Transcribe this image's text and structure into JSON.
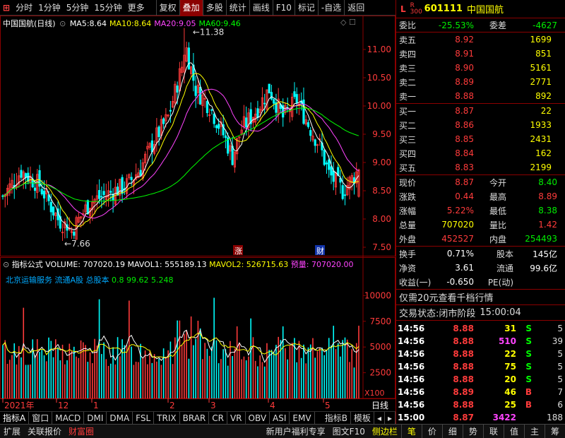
{
  "toolbar": {
    "periods": [
      "分时",
      "1分钟",
      "5分钟",
      "15分钟",
      "更多"
    ],
    "buttons": [
      "复权",
      "叠加",
      "多股",
      "统计",
      "画线",
      "F10",
      "标记",
      "-自选",
      "返回"
    ],
    "active": "叠加"
  },
  "price_chart": {
    "title": "中国国航(日线)",
    "ma": [
      {
        "name": "MA5:",
        "value": "8.64",
        "color": "#ffffff"
      },
      {
        "name": "MA10:",
        "value": "8.64",
        "color": "#ffff00"
      },
      {
        "name": "MA20:",
        "value": "9.05",
        "color": "#ff44ff"
      },
      {
        "name": "MA60:",
        "value": "9.46",
        "color": "#00ff00"
      }
    ],
    "high_label": "11.38",
    "low_label": "7.66",
    "markers": [
      "涨",
      "财"
    ]
  },
  "volume_chart": {
    "formula_label": "指标公式",
    "vol": {
      "name": "VOLUME:",
      "value": "707020.19"
    },
    "mavol1": {
      "name": "MAVOL1:",
      "value": "555189.13"
    },
    "mavol2": {
      "name": "MAVOL2:",
      "value": "526715.63"
    },
    "forecast": {
      "name": "预量:",
      "value": "707020.00"
    },
    "info_text": "北京运输服务 流通A股 总股本",
    "info_mixed": "0.8 99.62 5.248",
    "unit": "X100"
  },
  "time_axis": {
    "labels": [
      "2021年",
      "12",
      "1",
      "2",
      "3",
      "4",
      "5"
    ],
    "period": "日线"
  },
  "chart_data": [
    {
      "type": "candlestick",
      "y_ticks": [
        7.5,
        8.0,
        8.5,
        9.0,
        9.5,
        10.0,
        10.5,
        11.0
      ],
      "ylim": [
        7.35,
        11.6
      ],
      "series": [
        {
          "name": "MA5",
          "value": 8.64
        },
        {
          "name": "MA10",
          "value": 8.64
        },
        {
          "name": "MA20",
          "value": 9.05
        },
        {
          "name": "MA60",
          "value": 9.46
        }
      ],
      "high": 11.38,
      "low": 7.66,
      "last_close": 8.87
    },
    {
      "type": "bar",
      "y_ticks": [
        2500,
        5000,
        7500,
        10000
      ],
      "ylim": [
        0,
        12500
      ],
      "unit": "X100",
      "series": [
        {
          "name": "VOLUME",
          "value": 707020.19
        },
        {
          "name": "MAVOL1",
          "value": 555189.13
        },
        {
          "name": "MAVOL2",
          "value": 526715.63
        }
      ]
    }
  ],
  "stock": {
    "type_letter": "L",
    "code": "601111",
    "name": "中国国航",
    "sub": "R 300"
  },
  "ratio": {
    "label1": "委比",
    "value1": "-25.53%",
    "label2": "委差",
    "value2": "-4627"
  },
  "asks": [
    {
      "label": "卖五",
      "price": "8.92",
      "vol": "1699"
    },
    {
      "label": "卖四",
      "price": "8.91",
      "vol": "851"
    },
    {
      "label": "卖三",
      "price": "8.90",
      "vol": "5161"
    },
    {
      "label": "卖二",
      "price": "8.89",
      "vol": "2771"
    },
    {
      "label": "卖一",
      "price": "8.88",
      "vol": "892"
    }
  ],
  "bids": [
    {
      "label": "买一",
      "price": "8.87",
      "vol": "22"
    },
    {
      "label": "买二",
      "price": "8.86",
      "vol": "1933"
    },
    {
      "label": "买三",
      "price": "8.85",
      "vol": "2431"
    },
    {
      "label": "买四",
      "price": "8.84",
      "vol": "162"
    },
    {
      "label": "买五",
      "price": "8.83",
      "vol": "2199"
    }
  ],
  "stats": [
    {
      "l1": "现价",
      "v1": "8.87",
      "c1": "red",
      "l2": "今开",
      "v2": "8.40",
      "c2": "green"
    },
    {
      "l1": "涨跌",
      "v1": "0.44",
      "c1": "red",
      "l2": "最高",
      "v2": "8.89",
      "c2": "red"
    },
    {
      "l1": "涨幅",
      "v1": "5.22%",
      "c1": "red",
      "l2": "最低",
      "v2": "8.38",
      "c2": "green"
    },
    {
      "l1": "总量",
      "v1": "707020",
      "c1": "yellow",
      "l2": "量比",
      "v2": "1.42",
      "c2": "red"
    },
    {
      "l1": "外盘",
      "v1": "452527",
      "c1": "red",
      "l2": "内盘",
      "v2": "254493",
      "c2": "green"
    }
  ],
  "stats2": [
    {
      "l1": "换手",
      "v1": "0.71%",
      "l2": "股本",
      "v2": "145亿"
    },
    {
      "l1": "净资",
      "v1": "3.61",
      "l2": "流通",
      "v2": "99.6亿"
    },
    {
      "l1": "收益(一)",
      "v1": "-0.650",
      "l2": "PE(动)",
      "v2": ""
    }
  ],
  "promo": "仅需20元查看千档行情",
  "trade_status": {
    "label": "交易状态:",
    "value": "闭市阶段",
    "time": "15:00:04"
  },
  "ticks": [
    {
      "time": "14:56",
      "price": "8.88",
      "vol": "31",
      "side": "S",
      "count": "5",
      "vc": "#ffff00",
      "sc": "#00ff00"
    },
    {
      "time": "14:56",
      "price": "8.88",
      "vol": "510",
      "side": "S",
      "count": "39",
      "vc": "#ff44ff",
      "sc": "#00ff00"
    },
    {
      "time": "14:56",
      "price": "8.88",
      "vol": "22",
      "side": "S",
      "count": "5",
      "vc": "#ffff00",
      "sc": "#00ff00"
    },
    {
      "time": "14:56",
      "price": "8.88",
      "vol": "75",
      "side": "S",
      "count": "5",
      "vc": "#ffff00",
      "sc": "#00ff00"
    },
    {
      "time": "14:56",
      "price": "8.88",
      "vol": "20",
      "side": "S",
      "count": "5",
      "vc": "#ffff00",
      "sc": "#00ff00"
    },
    {
      "time": "14:56",
      "price": "8.89",
      "vol": "46",
      "side": "B",
      "count": "7",
      "vc": "#ffff00",
      "sc": "#ff3b3b"
    },
    {
      "time": "14:56",
      "price": "8.88",
      "vol": "25",
      "side": "B",
      "count": "6",
      "vc": "#ffff00",
      "sc": "#ff3b3b"
    },
    {
      "time": "15:00",
      "price": "8.87",
      "vol": "3422",
      "side": "",
      "count": "188",
      "vc": "#ff44ff",
      "sc": "#ffffff"
    }
  ],
  "indicator_tabs": [
    "指标A",
    "窗口",
    "MACD",
    "DMI",
    "DMA",
    "FSL",
    "TRIX",
    "BRAR",
    "CR",
    "VR",
    "OBV",
    "ASI",
    "EMV"
  ],
  "indicator_tabs_right": [
    "指标B",
    "模板"
  ],
  "status_left": [
    "扩展",
    "关联报价",
    "财富圈"
  ],
  "status_mid": [
    "新用户福利专享",
    "图文F10",
    "侧边栏"
  ],
  "status_right": [
    "笔",
    "价",
    "细",
    "势",
    "联",
    "值",
    "主",
    "筹"
  ],
  "colors": {
    "up": "#ff3b3b",
    "down": "#00ffff",
    "ma5": "#ffffff",
    "ma10": "#ffff00",
    "ma20": "#ff44ff",
    "ma60": "#00ff00",
    "border": "#8b0000"
  }
}
